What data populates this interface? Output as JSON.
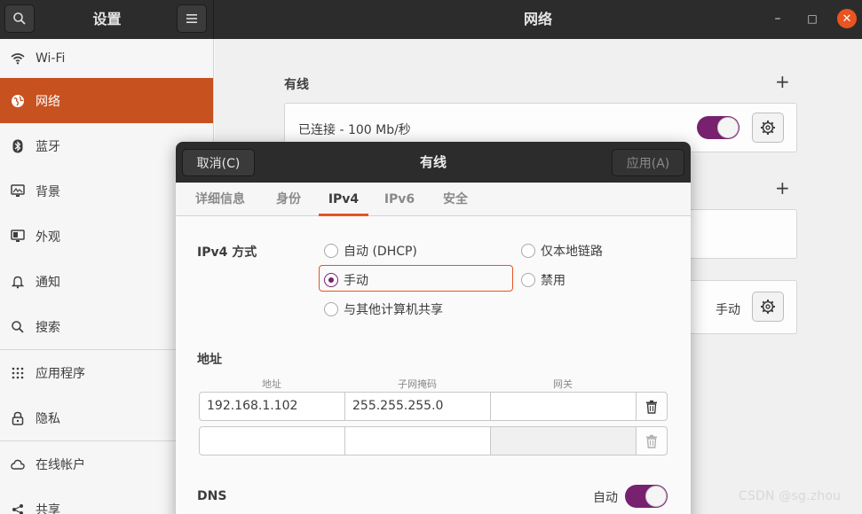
{
  "app": {
    "sidebar_title": "设置",
    "main_title": "网络",
    "search_icon": "search-icon",
    "menu_icon": "hamburger-menu-icon",
    "minimize": "–",
    "maximize": "□",
    "close": "✕"
  },
  "sidebar": {
    "items": [
      {
        "label": "Wi-Fi",
        "icon": "wifi-icon",
        "active": false
      },
      {
        "label": "网络",
        "icon": "network-icon",
        "active": true
      },
      {
        "label": "蓝牙",
        "icon": "bluetooth-icon",
        "active": false
      },
      {
        "label": "背景",
        "icon": "background-icon",
        "active": false
      },
      {
        "label": "外观",
        "icon": "appearance-icon",
        "active": false
      },
      {
        "label": "通知",
        "icon": "bell-icon",
        "active": false
      },
      {
        "label": "搜索",
        "icon": "search-icon",
        "active": false
      },
      {
        "label": "应用程序",
        "icon": "apps-grid-icon",
        "active": false
      },
      {
        "label": "隐私",
        "icon": "lock-icon",
        "active": false
      },
      {
        "label": "在线帐户",
        "icon": "cloud-icon",
        "active": false
      },
      {
        "label": "共享",
        "icon": "share-icon",
        "active": false
      }
    ]
  },
  "content": {
    "wired_title": "有线",
    "wired_status": "已连接 - 100 Mb/秒",
    "proxy_value": "手动",
    "plus": "+"
  },
  "dialog": {
    "title": "有线",
    "cancel_label": "取消(C)",
    "apply_label": "应用(A)",
    "tabs": [
      "详细信息",
      "身份",
      "IPv4",
      "IPv6",
      "安全"
    ],
    "active_tab": "IPv4",
    "ipv4_method_label": "IPv4 方式",
    "methods": {
      "auto": "自动 (DHCP)",
      "link_local": "仅本地链路",
      "manual": "手动",
      "disable": "禁用",
      "shared": "与其他计算机共享"
    },
    "selected_method": "manual",
    "address_section": "地址",
    "columns": {
      "address": "地址",
      "netmask": "子网掩码",
      "gateway": "网关"
    },
    "rows": [
      {
        "address": "192.168.1.102",
        "netmask": "255.255.255.0",
        "gateway": ""
      },
      {
        "address": "",
        "netmask": "",
        "gateway": ""
      }
    ],
    "dns_label": "DNS",
    "dns_auto_label": "自动",
    "dns_auto_on": true
  },
  "watermark": "CSDN @sg.zhou",
  "colors": {
    "accent": "#e95420",
    "sidebar_active": "#c7511f",
    "switch": "#77216f",
    "header": "#2c2c2c"
  }
}
